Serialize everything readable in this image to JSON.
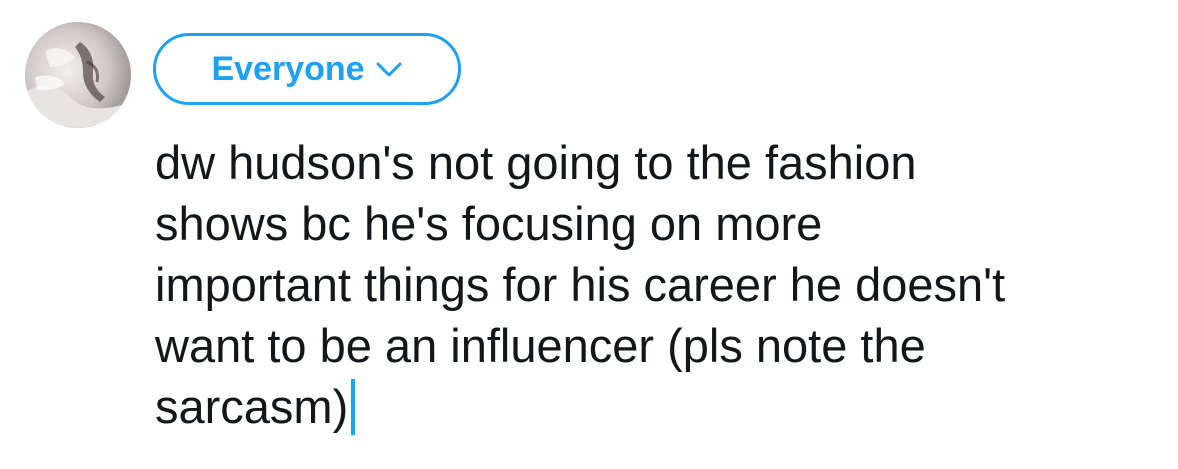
{
  "colors": {
    "accent": "#1da1f2",
    "text": "#14171a",
    "background": "#ffffff"
  },
  "avatar": {
    "icon": "user-avatar-photo"
  },
  "audience": {
    "label": "Everyone",
    "icon": "chevron-down-icon"
  },
  "composer": {
    "lines": [
      "dw hudson's not going to the fashion",
      "shows bc he's focusing on more",
      "important things for his career he doesn't",
      "want to be an influencer (pls note the",
      "sarcasm)"
    ]
  }
}
